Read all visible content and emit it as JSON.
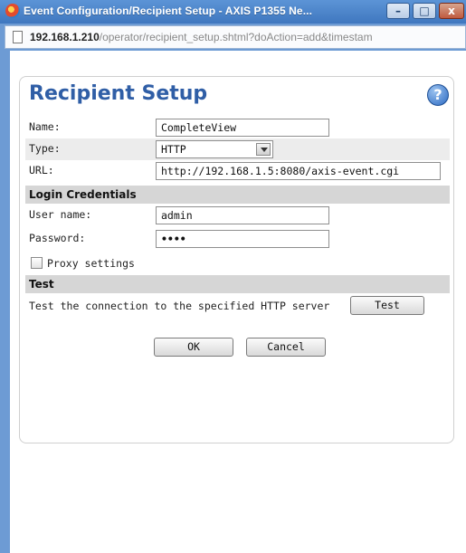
{
  "window": {
    "title": "Event Configuration/Recipient Setup - AXIS P1355 Ne...",
    "minimize": "–",
    "maximize": "□",
    "close": "x"
  },
  "address": {
    "host": "192.168.1.210",
    "path": "/operator/recipient_setup.shtml?doAction=add&timestam"
  },
  "page": {
    "heading": "Recipient Setup",
    "help": "?"
  },
  "form": {
    "name_label": "Name:",
    "name_value": "CompleteView",
    "type_label": "Type:",
    "type_value": "HTTP",
    "url_label": "URL:",
    "url_value": "http://192.168.1.5:8080/axis-event.cgi",
    "login_section": "Login Credentials",
    "username_label": "User name:",
    "username_value": "admin",
    "password_label": "Password:",
    "password_value": "••••",
    "proxy_label": "Proxy settings",
    "proxy_checked": false,
    "test_section": "Test",
    "test_text": "Test the connection to the specified HTTP server",
    "test_button": "Test",
    "ok_button": "OK",
    "cancel_button": "Cancel"
  },
  "colors": {
    "heading": "#2f5ea6",
    "frame": "#6d9bd4",
    "section_bg": "#d6d6d6"
  }
}
